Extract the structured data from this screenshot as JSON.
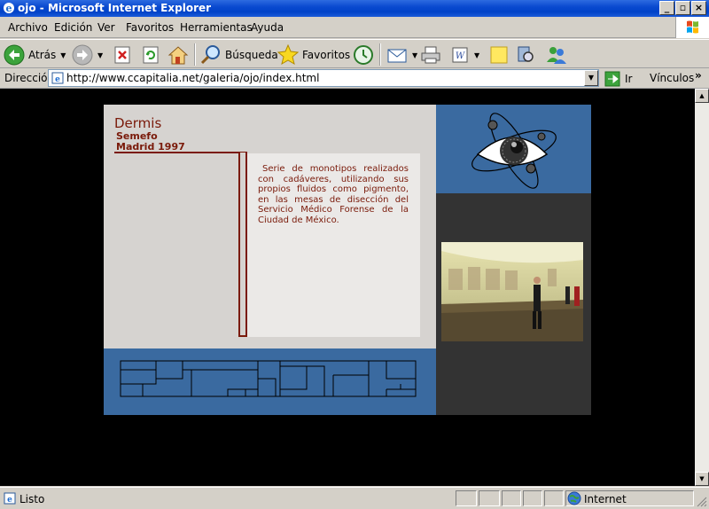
{
  "window": {
    "title": "ojo - Microsoft Internet Explorer"
  },
  "menu": {
    "items": [
      {
        "label": "Archivo"
      },
      {
        "label": "Edición"
      },
      {
        "label": "Ver"
      },
      {
        "label": "Favoritos"
      },
      {
        "label": "Herramientas"
      },
      {
        "label": "Ayuda"
      }
    ]
  },
  "toolbar": {
    "back_label": "Atrás",
    "search_label": "Búsqueda",
    "favorites_label": "Favoritos",
    "icons": [
      "back-arrow-icon",
      "forward-arrow-icon",
      "stop-icon",
      "refresh-icon",
      "home-icon",
      "search-icon",
      "favorites-star-icon",
      "history-icon",
      "mail-icon",
      "print-icon",
      "edit-icon",
      "discuss-icon",
      "research-icon",
      "messenger-icon"
    ]
  },
  "address": {
    "label": "Dirección",
    "url": "http://www.ccapitalia.net/galeria/ojo/index.html",
    "go_label": "Ir",
    "links_label": "Vínculos"
  },
  "page": {
    "title": "Dermis",
    "subtitle1": "Semefo",
    "subtitle2": "Madrid 1997",
    "description": "Serie de monotipos realizados con cadáveres, utilizando sus propios fluidos como pigmento, en las mesas de disección del Servicio Médico Forense de la Ciudad de México.",
    "colors": {
      "accent": "#7a1a0a",
      "blue_panel": "#3a6aa0",
      "gray_panel": "#333333"
    }
  },
  "status": {
    "text": "Listo",
    "zone": "Internet"
  }
}
